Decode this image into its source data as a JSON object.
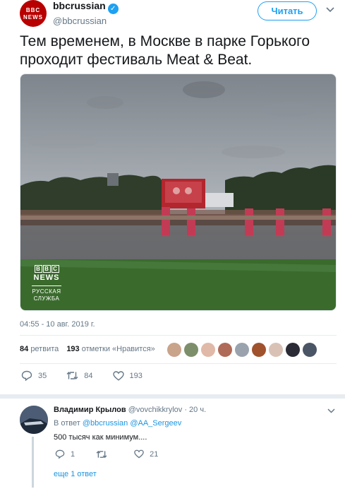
{
  "tweet": {
    "avatar_text_1": "BBC",
    "avatar_text_2": "NEWS",
    "display_name": "bbcrussian",
    "handle": "@bbcrussian",
    "follow_label": "Читать",
    "text": "Тем временем, в Москве в парке Горького проходит фестиваль Meat & Beat.",
    "photo": {
      "watermark_letters": [
        "B",
        "B",
        "C"
      ],
      "watermark_news": "NEWS",
      "watermark_line1": "РУССКАЯ",
      "watermark_line2": "СЛУЖБА"
    },
    "timestamp": "04:55 - 10 авг. 2019 г.",
    "retweets_count": "84",
    "retweets_label": "ретвита",
    "likes_count": "193",
    "likes_label": "отметки «Нравится»",
    "liker_colors": [
      "#c9a38a",
      "#7d8f6a",
      "#e0b9a8",
      "#b06a58",
      "#9aa3ad",
      "#a0522d",
      "#d9c2b5",
      "#2b2b36",
      "#4a5565"
    ],
    "actions": {
      "replies": "35",
      "retweets": "84",
      "likes": "193"
    }
  },
  "reply": {
    "name": "Владимир Крылов",
    "handle": "@vovchikkrylov",
    "time": "· 20 ч.",
    "reply_to_prefix": "В ответ",
    "mention_1": "@bbcrussian",
    "mention_2": "@AA_Sergeev",
    "text": "500 тысяч как минимум....",
    "replies": "1",
    "retweets": "",
    "likes": "21",
    "more_replies": "еще 1 ответ"
  },
  "colors": {
    "accent": "#1da1f2",
    "brand_red": "#b80000",
    "muted": "#657786"
  }
}
